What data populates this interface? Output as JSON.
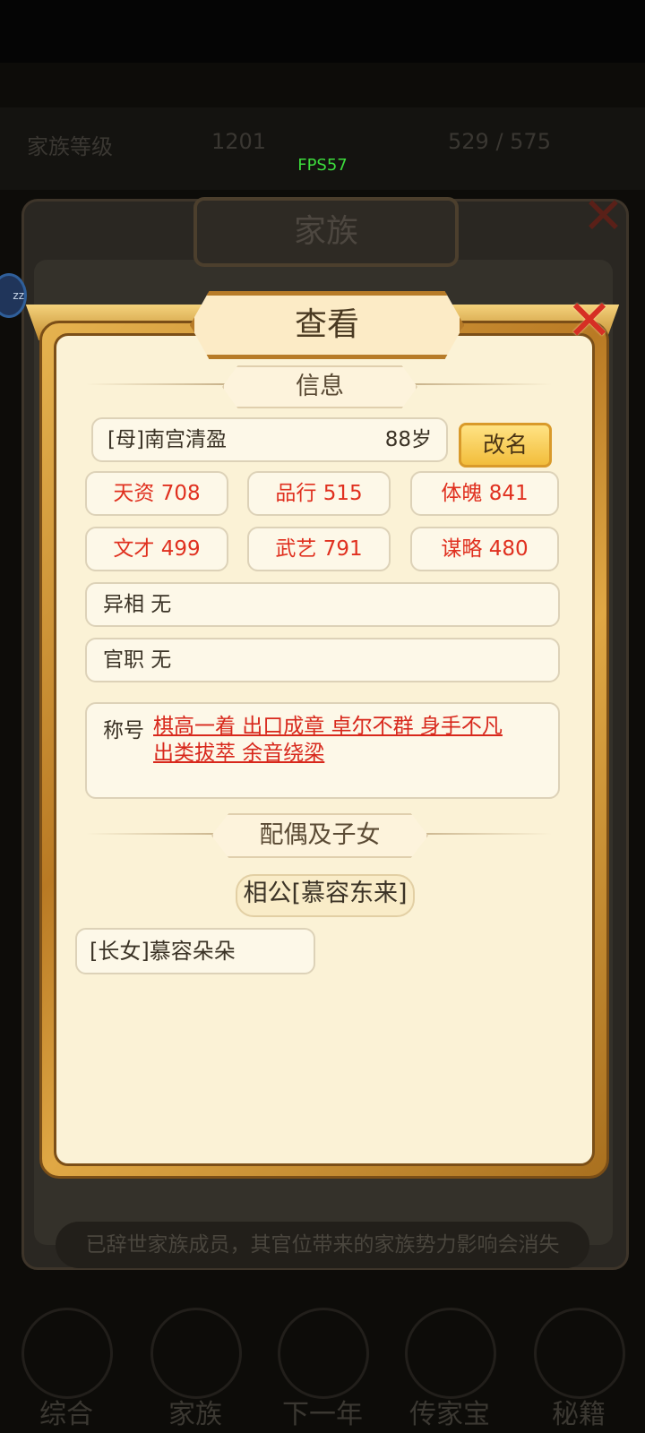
{
  "fps": "FPS57",
  "background_screen": {
    "panel_title": "家族",
    "footer_notice": "已辞世家族成员，其官位带来的家族势力影响会消失",
    "status_left": "家族等级",
    "status_mid": "1201",
    "status_right": "529 / 575",
    "nav": [
      "综合",
      "家族",
      "下一年",
      "传家宝",
      "秘籍"
    ]
  },
  "dialog": {
    "title": "查看",
    "info_section": "信息",
    "member": {
      "name": "[母]南宫清盈",
      "age": "88岁"
    },
    "rename_button": "改名",
    "stats": [
      {
        "label": "天资 708"
      },
      {
        "label": "品行 515"
      },
      {
        "label": "体魄 841"
      },
      {
        "label": "文才 499"
      },
      {
        "label": "武艺 791"
      },
      {
        "label": "谋略 480"
      }
    ],
    "yixiang": "异相 无",
    "guanzhi": "官职 无",
    "titles_label": "称号",
    "titles_text": "棋高一着 出口成章 卓尔不群 身手不凡 出类拔萃 余音绕梁",
    "family_section": "配偶及子女",
    "spouse": "相公[慕容东来]",
    "children": [
      "[长女]慕容朵朵"
    ]
  },
  "colors": {
    "stat_red": "#e0301f",
    "close_red": "#d62f24",
    "paper": "#fbf2d6",
    "gold": "#f2bd3b"
  }
}
